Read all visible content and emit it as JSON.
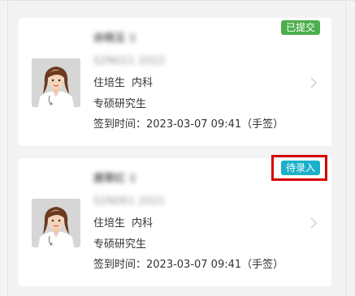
{
  "cards": [
    {
      "status": "已提交",
      "status_color": "#4cae4c",
      "name": "余晓玉 ♀",
      "sub": "S2N021   2022",
      "role": "住培生",
      "dept": "内科",
      "type": "专硕研究生",
      "checkin": "签到时间：2023-03-07 09:41（手签）"
    },
    {
      "status": "待录入",
      "status_color": "#1bb0c9",
      "name": "唐翠红 ♀",
      "sub": "S2N061   2021",
      "role": "住培生",
      "dept": "内科",
      "type": "专硕研究生",
      "checkin": "签到时间：2023-03-07 09:41（手签）"
    }
  ],
  "highlight_color": "#d40000",
  "icons": [
    "doctor-avatar-icon",
    "chevron-right-icon"
  ]
}
